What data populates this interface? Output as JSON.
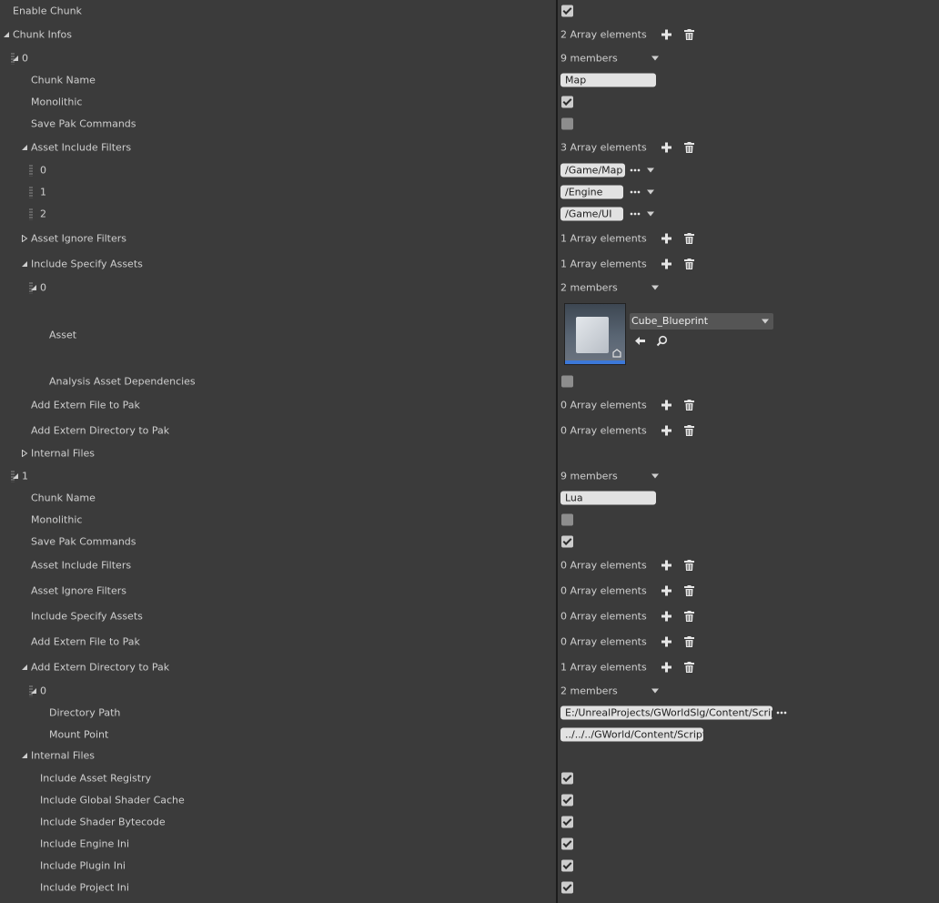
{
  "rows": [
    {
      "label": "Enable Chunk",
      "indent": 14,
      "value": {
        "type": "checkbox",
        "checked": true
      }
    },
    {
      "label": "Chunk Infos",
      "indent": 14,
      "arrow": "expanded",
      "value": {
        "type": "array",
        "text": "2 Array elements"
      }
    },
    {
      "label": "0",
      "indent": 24,
      "arrow": "expanded",
      "grip": true,
      "value": {
        "type": "members",
        "text": "9 members"
      }
    },
    {
      "label": "Chunk Name",
      "indent": 34,
      "value": {
        "type": "text",
        "text": "Map",
        "width": 105
      }
    },
    {
      "label": "Monolithic",
      "indent": 34,
      "value": {
        "type": "checkbox",
        "checked": true
      }
    },
    {
      "label": "Save Pak Commands",
      "indent": 34,
      "value": {
        "type": "checkbox",
        "checked": false
      }
    },
    {
      "label": "Asset Include Filters",
      "indent": 34,
      "arrow": "expanded",
      "value": {
        "type": "array",
        "text": "3 Array elements"
      }
    },
    {
      "label": "0",
      "indent": 44,
      "grip": true,
      "value": {
        "type": "path",
        "text": "/Game/Map",
        "width": 71
      }
    },
    {
      "label": "1",
      "indent": 44,
      "grip": true,
      "value": {
        "type": "path",
        "text": "/Engine",
        "width": 69
      }
    },
    {
      "label": "2",
      "indent": 44,
      "grip": true,
      "value": {
        "type": "path",
        "text": "/Game/UI",
        "width": 69
      }
    },
    {
      "label": "Asset Ignore Filters",
      "indent": 34,
      "arrow": "collapsed",
      "value": {
        "type": "array",
        "text": "1 Array elements"
      }
    },
    {
      "label": "Include Specify Assets",
      "indent": 34,
      "arrow": "expanded",
      "value": {
        "type": "array",
        "text": "1 Array elements"
      }
    },
    {
      "label": "0",
      "indent": 44,
      "arrow": "expanded",
      "grip": true,
      "value": {
        "type": "members",
        "text": "2 members"
      }
    },
    {
      "label": "Asset",
      "indent": 54,
      "value": {
        "type": "asset",
        "text": "Cube_Blueprint"
      }
    },
    {
      "label": "Analysis Asset Dependencies",
      "indent": 54,
      "value": {
        "type": "checkbox",
        "checked": false
      }
    },
    {
      "label": "Add Extern File to Pak",
      "indent": 34,
      "value": {
        "type": "array",
        "text": "0 Array elements"
      }
    },
    {
      "label": "Add Extern Directory to Pak",
      "indent": 34,
      "value": {
        "type": "array",
        "text": "0 Array elements"
      }
    },
    {
      "label": "Internal Files",
      "indent": 34,
      "arrow": "collapsed",
      "value": {
        "type": "none"
      }
    },
    {
      "label": "1",
      "indent": 24,
      "arrow": "expanded",
      "grip": true,
      "value": {
        "type": "members",
        "text": "9 members"
      }
    },
    {
      "label": "Chunk Name",
      "indent": 34,
      "value": {
        "type": "text",
        "text": "Lua",
        "width": 105
      }
    },
    {
      "label": "Monolithic",
      "indent": 34,
      "value": {
        "type": "checkbox",
        "checked": false
      }
    },
    {
      "label": "Save Pak Commands",
      "indent": 34,
      "value": {
        "type": "checkbox",
        "checked": true
      }
    },
    {
      "label": "Asset Include Filters",
      "indent": 34,
      "value": {
        "type": "array",
        "text": "0 Array elements"
      }
    },
    {
      "label": "Asset Ignore Filters",
      "indent": 34,
      "value": {
        "type": "array",
        "text": "0 Array elements"
      }
    },
    {
      "label": "Include Specify Assets",
      "indent": 34,
      "value": {
        "type": "array",
        "text": "0 Array elements"
      }
    },
    {
      "label": "Add Extern File to Pak",
      "indent": 34,
      "value": {
        "type": "array",
        "text": "0 Array elements"
      }
    },
    {
      "label": "Add Extern Directory to Pak",
      "indent": 34,
      "arrow": "expanded",
      "value": {
        "type": "array",
        "text": "1 Array elements"
      }
    },
    {
      "label": "0",
      "indent": 44,
      "arrow": "expanded",
      "grip": true,
      "value": {
        "type": "members",
        "text": "2 members"
      }
    },
    {
      "label": "Directory Path",
      "indent": 54,
      "value": {
        "type": "text",
        "text": "E:/UnrealProjects/GWorldSlg/Content/Script",
        "width": 233,
        "dots": true
      }
    },
    {
      "label": "Mount Point",
      "indent": 54,
      "value": {
        "type": "text",
        "text": "../../../GWorld/Content/Script",
        "width": 157
      }
    },
    {
      "label": "Internal Files",
      "indent": 34,
      "arrow": "expanded",
      "value": {
        "type": "none"
      }
    },
    {
      "label": "Include Asset Registry",
      "indent": 44,
      "value": {
        "type": "checkbox",
        "checked": true
      }
    },
    {
      "label": "Include Global Shader Cache",
      "indent": 44,
      "value": {
        "type": "checkbox",
        "checked": true
      }
    },
    {
      "label": "Include Shader Bytecode",
      "indent": 44,
      "value": {
        "type": "checkbox",
        "checked": true
      }
    },
    {
      "label": "Include Engine Ini",
      "indent": 44,
      "value": {
        "type": "checkbox",
        "checked": true
      }
    },
    {
      "label": "Include Plugin Ini",
      "indent": 44,
      "value": {
        "type": "checkbox",
        "checked": true
      }
    },
    {
      "label": "Include Project Ini",
      "indent": 44,
      "value": {
        "type": "checkbox",
        "checked": true
      }
    }
  ]
}
